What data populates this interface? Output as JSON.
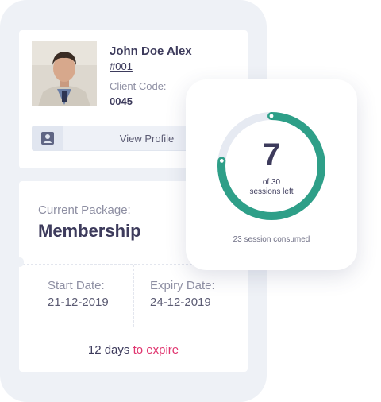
{
  "client": {
    "name": "John Doe Alex",
    "id": "#001",
    "code_label": "Client Code:",
    "code_value": "0045",
    "view_profile_label": "View Profile",
    "avatar_icon": "person-photo"
  },
  "package": {
    "label": "Current Package:",
    "name": "Membership",
    "start_label": "Start Date:",
    "start_value": "21-12-2019",
    "expiry_label": "Expiry Date:",
    "expiry_value": "24-12-2019",
    "expire_days": "12 days",
    "expire_text": "to expire"
  },
  "sessions": {
    "remaining": "7",
    "of_total": "of 30",
    "left_label": "sessions left",
    "consumed_text": "23 session consumed",
    "remaining_fraction": 0.7667,
    "ring_color": "#2e9f88",
    "track_color": "#e6eaf2"
  },
  "colors": {
    "accent": "#e0356f",
    "text_dark": "#3d3b5c",
    "text_muted": "#8e8fa3",
    "background": "#eef1f6"
  }
}
